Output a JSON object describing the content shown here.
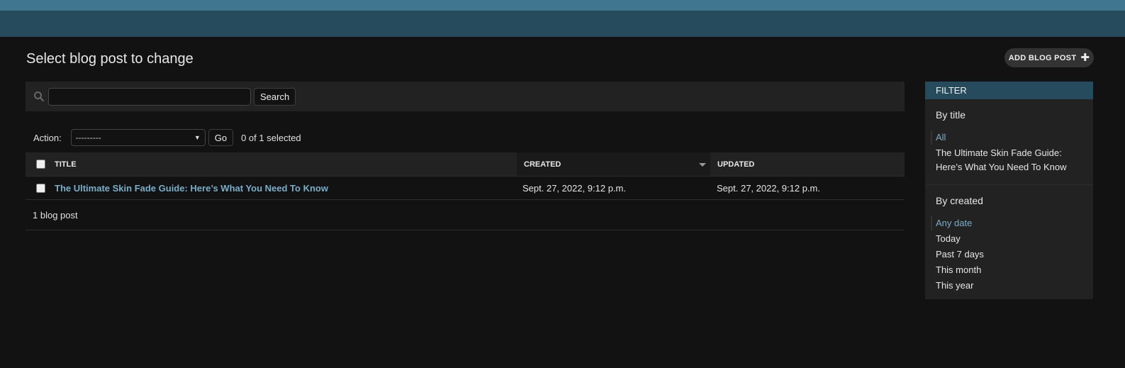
{
  "header": {},
  "page": {
    "title": "Select blog post to change",
    "add_button_label": "ADD BLOG POST"
  },
  "search": {
    "placeholder": "",
    "value": "",
    "button_label": "Search"
  },
  "actions": {
    "label": "Action:",
    "selected_option": "---------",
    "go_label": "Go",
    "selected_count": "0 of 1 selected"
  },
  "table": {
    "columns": [
      "TITLE",
      "CREATED",
      "UPDATED"
    ],
    "rows": [
      {
        "title": "The Ultimate Skin Fade Guide: Here’s What You Need To Know",
        "created": "Sept. 27, 2022, 9:12 p.m.",
        "updated": "Sept. 27, 2022, 9:12 p.m."
      }
    ],
    "footer": "1 blog post"
  },
  "filter": {
    "header": "FILTER",
    "by_title": {
      "label": "By title",
      "options": [
        "All",
        "The Ultimate Skin Fade Guide: Here’s What You Need To Know"
      ]
    },
    "by_created": {
      "label": "By created",
      "options": [
        "Any date",
        "Today",
        "Past 7 days",
        "This month",
        "This year"
      ]
    }
  },
  "colors": {
    "topbar": "#417690",
    "header_band": "#264b5d",
    "link": "#79aec8",
    "background": "#121212"
  }
}
